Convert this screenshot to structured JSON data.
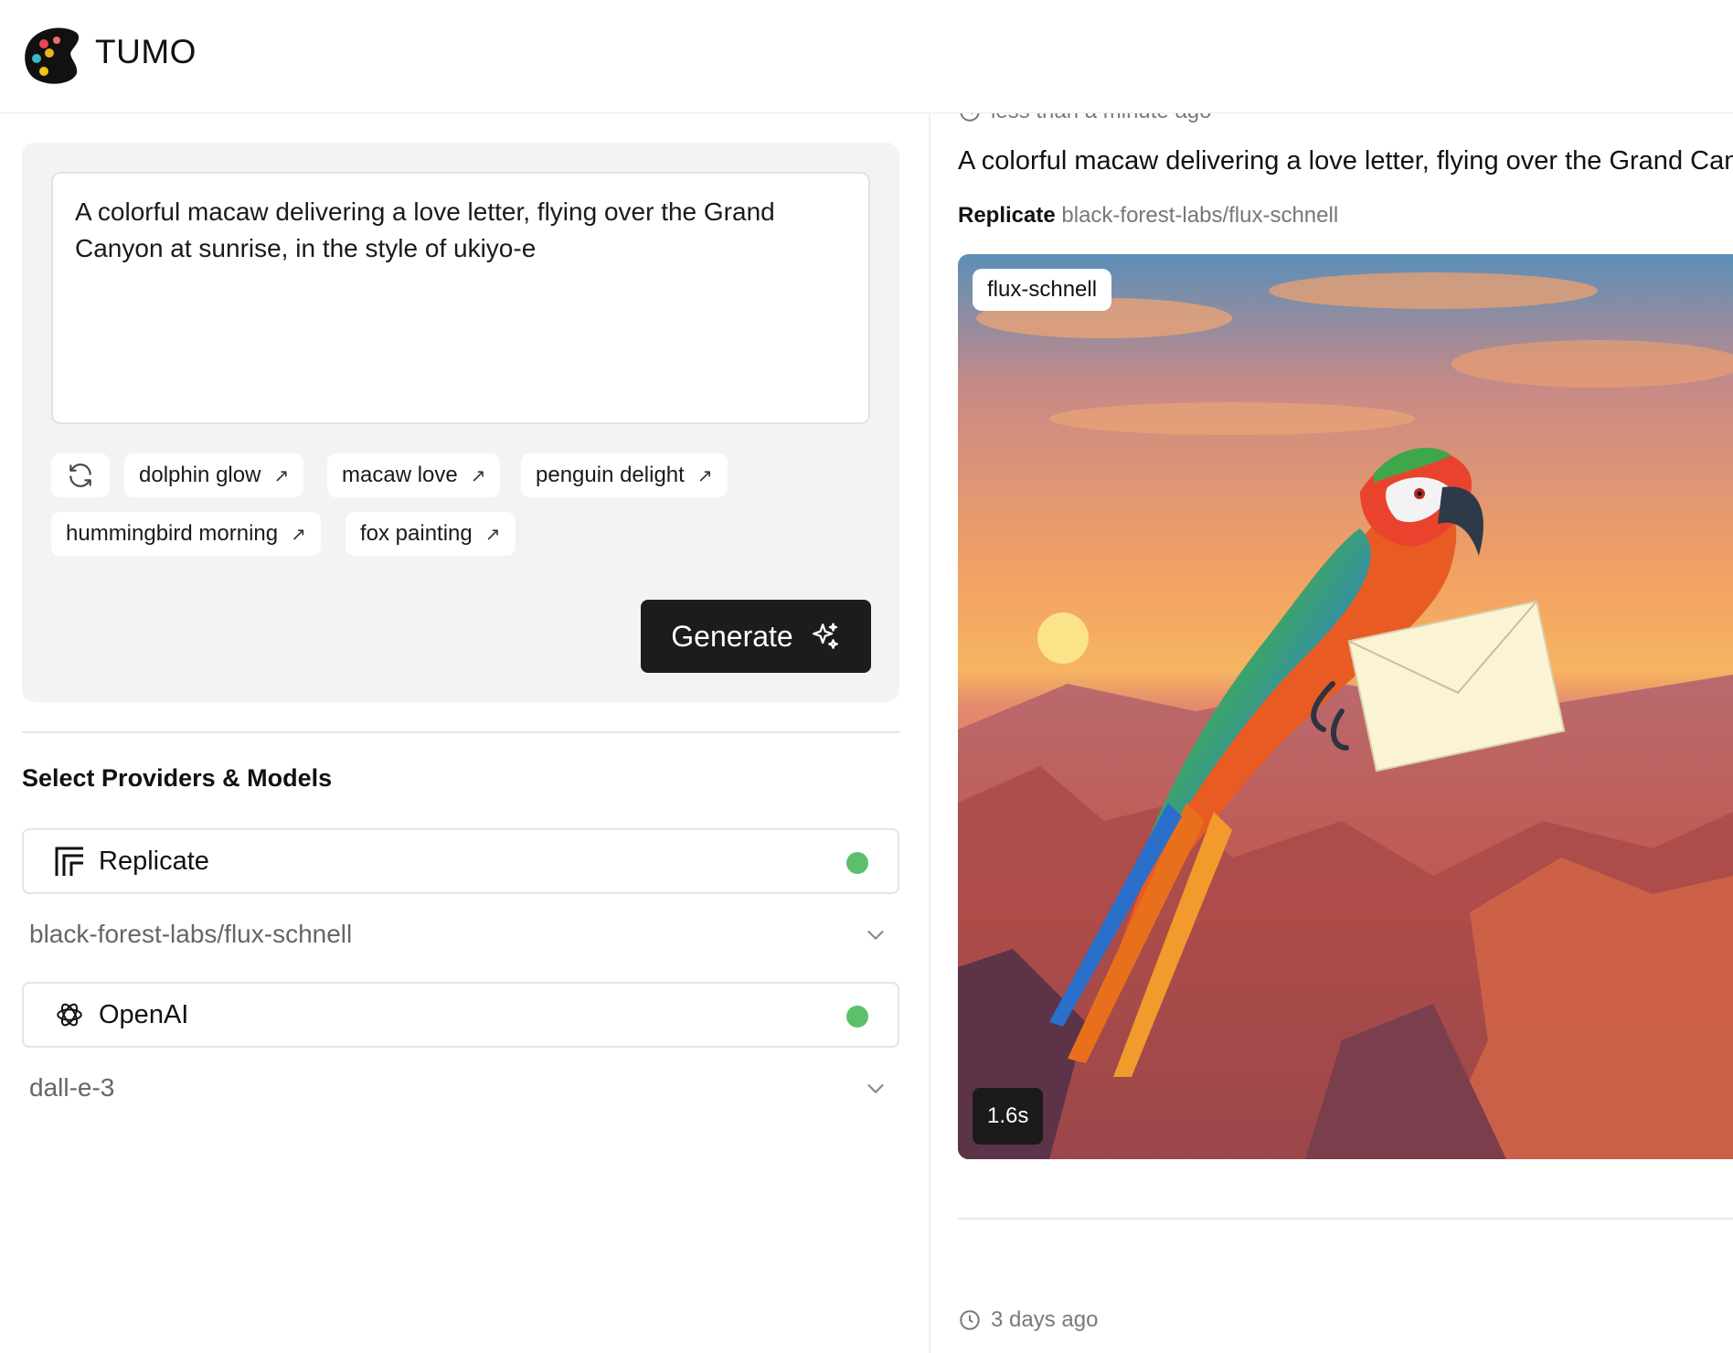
{
  "app": {
    "name": "TUMO"
  },
  "prompt": {
    "text": "A colorful macaw delivering a love letter, flying over the Grand Canyon at sunrise, in the style of ukiyo-e"
  },
  "suggestions": [
    {
      "label": "dolphin glow"
    },
    {
      "label": "macaw love"
    },
    {
      "label": "penguin delight"
    },
    {
      "label": "hummingbird morning"
    },
    {
      "label": "fox painting"
    }
  ],
  "actions": {
    "generate_label": "Generate"
  },
  "providers_section": {
    "title": "Select Providers & Models",
    "providers": [
      {
        "name": "Replicate",
        "status_color": "#5cbf6a",
        "model": "black-forest-labs/flux-schnell"
      },
      {
        "name": "OpenAI",
        "status_color": "#5cbf6a",
        "model": "dall-e-3"
      }
    ]
  },
  "results": [
    {
      "time": "less than a minute ago",
      "prompt": "A colorful macaw delivering a love letter, flying over the Grand Canyon at sunrise, in the style of ukiyo-e",
      "provider": "Replicate",
      "model": "black-forest-labs/flux-schnell",
      "model_badge": "flux-schnell",
      "duration": "1.6s"
    },
    {
      "time": "3 days ago"
    }
  ],
  "icons": {
    "logo": "palette-icon",
    "refresh": "refresh-icon",
    "suggestion_arrow": "arrow-up-right-icon",
    "generate": "sparkles-icon",
    "replicate": "replicate-logo-icon",
    "openai": "openai-logo-icon",
    "dropdown": "chevron-down-icon",
    "time": "clock-icon"
  },
  "colors": {
    "primary_button": "#1c1c1c",
    "card_bg": "#f3f3f3",
    "status_active": "#5cbf6a"
  }
}
